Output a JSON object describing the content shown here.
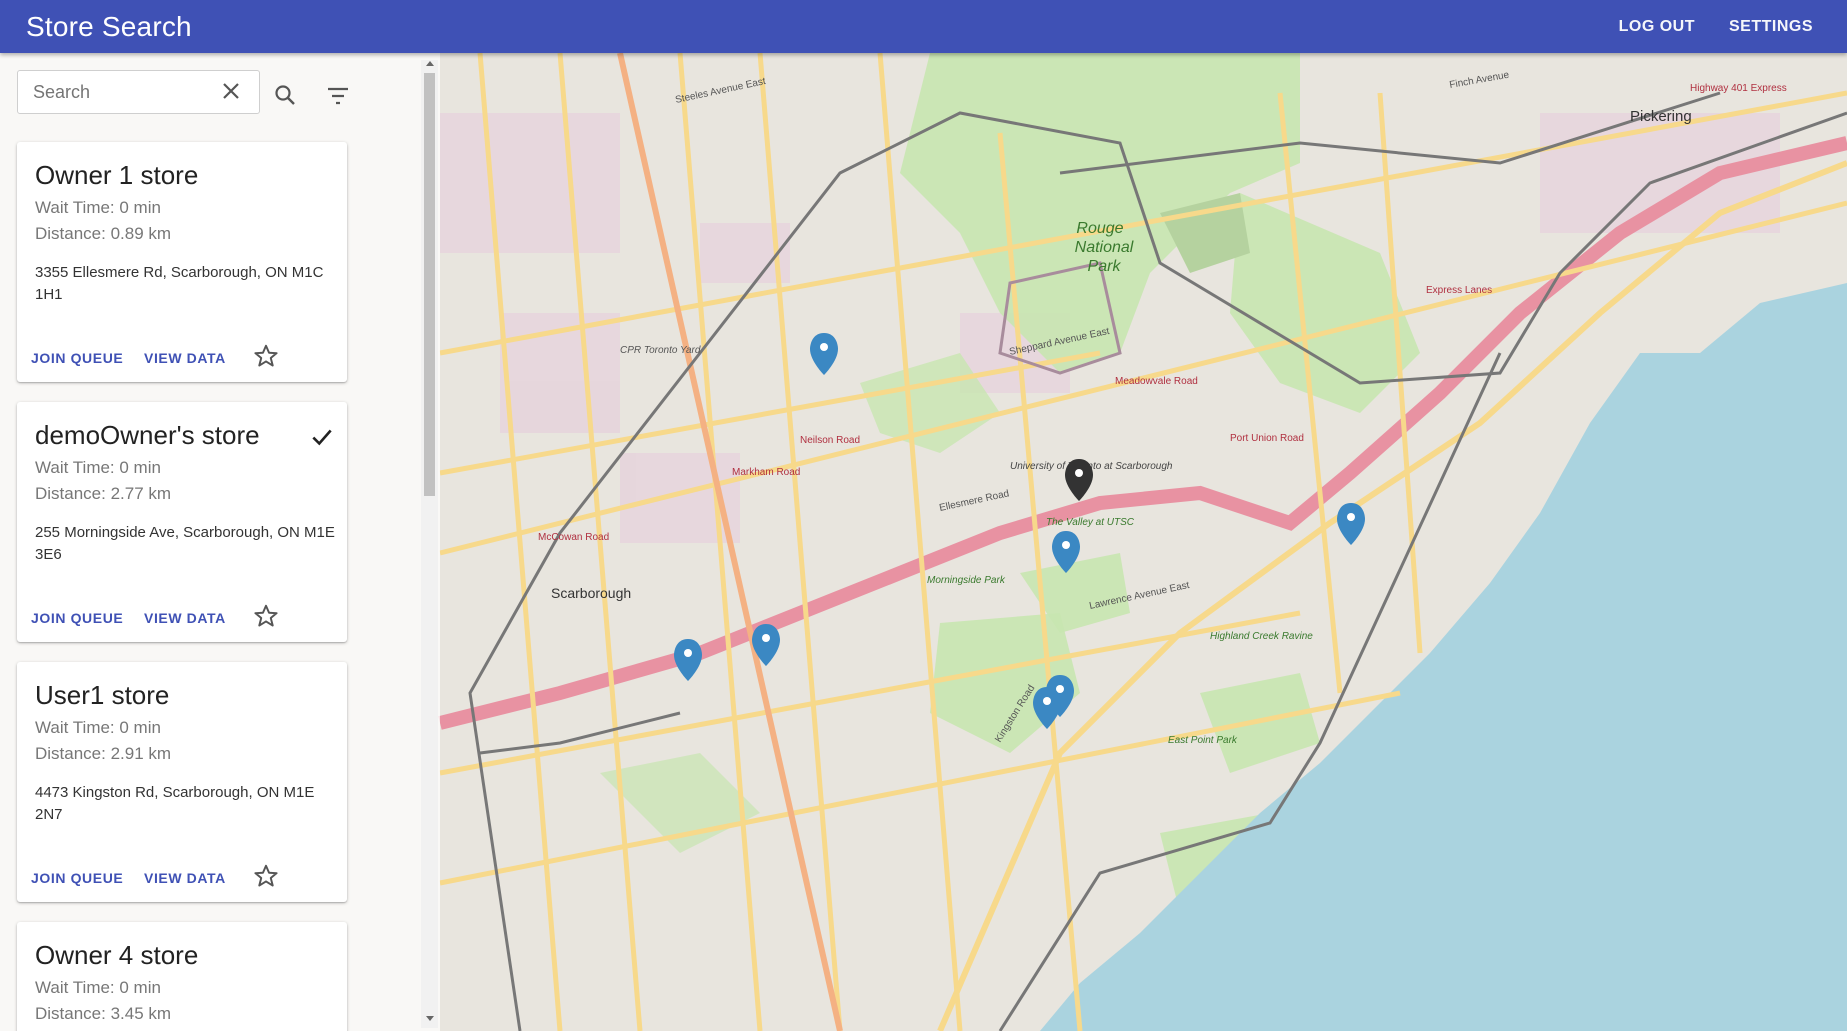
{
  "appbar": {
    "title": "Store Search",
    "logout_label": "LOG OUT",
    "settings_label": "SETTINGS",
    "color": "#3f51b5"
  },
  "search": {
    "placeholder": "Search",
    "value": ""
  },
  "stores": [
    {
      "name": "Owner 1 store",
      "wait": "Wait Time: 0 min",
      "distance": "Distance: 0.89 km",
      "address": "3355 Ellesmere Rd, Scarborough, ON M1C 1H1",
      "join_label": "JOIN QUEUE",
      "view_label": "VIEW DATA",
      "selected": false
    },
    {
      "name": "demoOwner's store",
      "wait": "Wait Time: 0 min",
      "distance": "Distance: 2.77 km",
      "address": "255 Morningside Ave, Scarborough, ON M1E 3E6",
      "join_label": "JOIN QUEUE",
      "view_label": "VIEW DATA",
      "selected": true
    },
    {
      "name": "User1 store",
      "wait": "Wait Time: 0 min",
      "distance": "Distance: 2.91 km",
      "address": "4473 Kingston Rd, Scarborough, ON M1E 2N7",
      "join_label": "JOIN QUEUE",
      "view_label": "VIEW DATA",
      "selected": false
    },
    {
      "name": "Owner 4 store",
      "wait": "Wait Time: 0 min",
      "distance": "Distance: 3.45 km"
    }
  ],
  "map": {
    "labels": {
      "rouge": "Rouge",
      "national": "National",
      "park": "Park",
      "pickering": "Pickering",
      "scarborough": "Scarborough",
      "sheppard": "Sheppard Avenue East",
      "ellesmere": "Ellesmere Road",
      "lawrence": "Lawrence Avenue East",
      "kingston": "Kingston Road",
      "finch": "Finch Avenue",
      "steeles": "Steeles Avenue East",
      "highway401": "Highway 401 Express",
      "morningside_park": "Morningside Park",
      "uoft": "University of Toronto at Scarborough",
      "valley": "The Valley at UTSC",
      "highland": "Highland Creek Ravine",
      "eastpoint": "East Point Park",
      "express": "Express Lanes",
      "port_union": "Port Union Road",
      "meadowvale": "Meadowvale Road",
      "mccowan": "McCowan Road",
      "markham": "Markham Road",
      "neilson": "Neilson Road",
      "cpr": "CPR Toronto Yard"
    },
    "water_color": "#aad3df",
    "land_color": "#f2efe9",
    "park_color": "#c8e6b0",
    "marker_color": "#3b88c3",
    "current_marker_color": "#333333"
  }
}
